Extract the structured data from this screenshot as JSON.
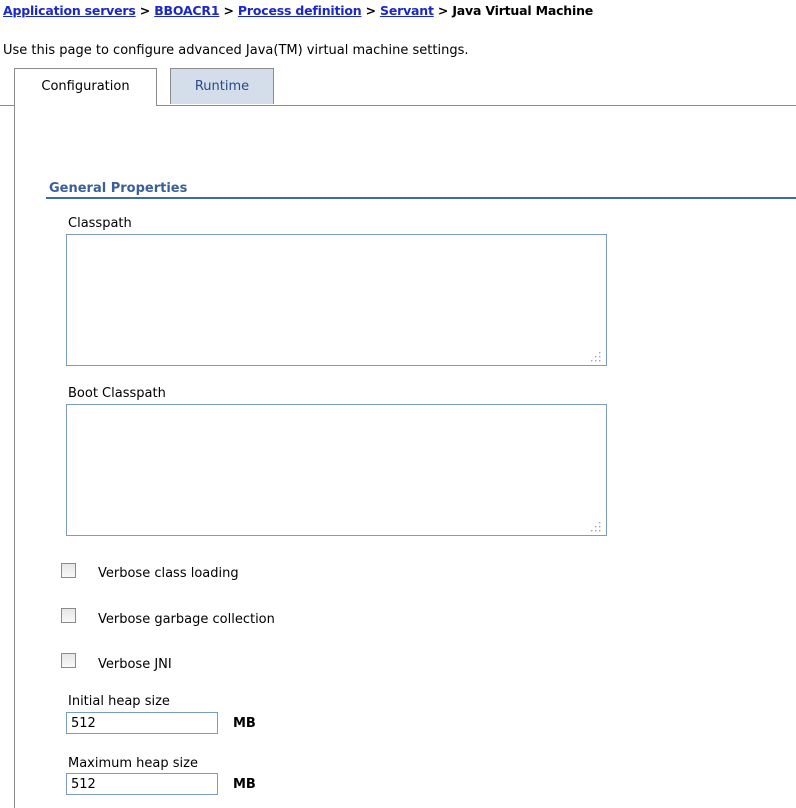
{
  "breadcrumb": {
    "links": [
      "Application servers",
      "BBOACR1",
      "Process definition",
      "Servant"
    ],
    "separator": ">",
    "current": "Java Virtual Machine"
  },
  "description": "Use this page to configure advanced Java(TM) virtual machine settings.",
  "tabs": [
    {
      "label": "Configuration",
      "active": true
    },
    {
      "label": "Runtime",
      "active": false
    }
  ],
  "section": {
    "title": "General Properties"
  },
  "fields": {
    "classpath": {
      "label": "Classpath",
      "value": ""
    },
    "boot_classpath": {
      "label": "Boot Classpath",
      "value": ""
    },
    "verbose_class_loading": {
      "label": "Verbose class loading",
      "checked": false
    },
    "verbose_gc": {
      "label": "Verbose garbage collection",
      "checked": false
    },
    "verbose_jni": {
      "label": "Verbose JNI",
      "checked": false
    },
    "initial_heap": {
      "label": "Initial heap size",
      "value": "512",
      "unit": "MB"
    },
    "maximum_heap": {
      "label": "Maximum heap size",
      "value": "512",
      "unit": "MB"
    }
  },
  "colors": {
    "link": "#1a28c8",
    "section_title": "#3a5f9a",
    "section_rule": "#3a6ca8",
    "input_border": "#7a9cc4",
    "inactive_tab_bg": "#d4deea"
  }
}
